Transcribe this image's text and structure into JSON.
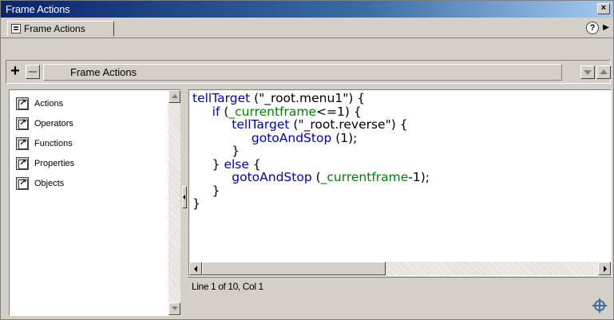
{
  "window": {
    "title": "Frame Actions",
    "close_glyph": "×"
  },
  "tabbar": {
    "tab_label": "Frame Actions",
    "help_glyph": "?",
    "menu_glyph": "▶"
  },
  "toolbar": {
    "add_glyph": "+",
    "path_label": "Frame Actions"
  },
  "sidebar": {
    "items": [
      {
        "label": "Actions"
      },
      {
        "label": "Operators"
      },
      {
        "label": "Functions"
      },
      {
        "label": "Properties"
      },
      {
        "label": "Objects"
      }
    ]
  },
  "editor": {
    "lines": [
      {
        "indent": "",
        "parts": [
          {
            "t": "kw",
            "v": "tellTarget"
          },
          {
            "t": "n",
            "v": " (\"_root.menu1\") {"
          }
        ]
      },
      {
        "indent": "     ",
        "parts": [
          {
            "t": "kw",
            "v": "if"
          },
          {
            "t": "n",
            "v": " ("
          },
          {
            "t": "prop",
            "v": "_currentframe"
          },
          {
            "t": "n",
            "v": "<=1) {"
          }
        ]
      },
      {
        "indent": "          ",
        "parts": [
          {
            "t": "kw",
            "v": "tellTarget"
          },
          {
            "t": "n",
            "v": " (\"_root.reverse\") {"
          }
        ]
      },
      {
        "indent": "               ",
        "parts": [
          {
            "t": "kw",
            "v": "gotoAndStop"
          },
          {
            "t": "n",
            "v": " (1);"
          }
        ]
      },
      {
        "indent": "          ",
        "parts": [
          {
            "t": "n",
            "v": "}"
          }
        ]
      },
      {
        "indent": "     ",
        "parts": [
          {
            "t": "n",
            "v": "} "
          },
          {
            "t": "kw",
            "v": "else"
          },
          {
            "t": "n",
            "v": " {"
          }
        ]
      },
      {
        "indent": "          ",
        "parts": [
          {
            "t": "kw",
            "v": "gotoAndStop"
          },
          {
            "t": "n",
            "v": " ("
          },
          {
            "t": "prop",
            "v": "_currentframe"
          },
          {
            "t": "n",
            "v": "-1);"
          }
        ]
      },
      {
        "indent": "     ",
        "parts": [
          {
            "t": "n",
            "v": "}"
          }
        ]
      },
      {
        "indent": "",
        "parts": [
          {
            "t": "n",
            "v": "}"
          }
        ]
      }
    ]
  },
  "status": {
    "text": "Line 1 of 10, Col 1"
  },
  "colors": {
    "keyword": "#0000b4",
    "property": "#008000",
    "title_bar": "#0a246a"
  }
}
